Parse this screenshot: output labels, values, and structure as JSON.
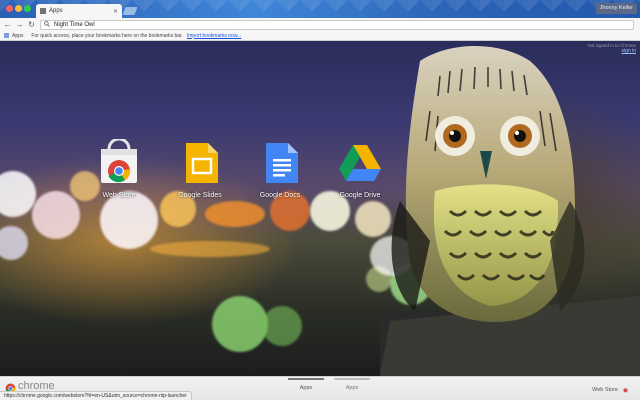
{
  "window": {
    "tab_title": "Night Time Owl",
    "tab_label": "Apps",
    "profile_name": "Jhonny Keller"
  },
  "toolbar": {
    "omnibox_text": "Night Time Owl"
  },
  "bookmarks": {
    "apps_label": "Apps",
    "hint_text": "For quick access, place your bookmarks here on the bookmarks bar.",
    "import_link": "Import bookmarks now..."
  },
  "account": {
    "signed_out_note": "Not signed in to Chrome",
    "signin_link": "sign in"
  },
  "apps": [
    {
      "label": "Web Store",
      "icon": "chrome-web-store-icon"
    },
    {
      "label": "Google Slides",
      "icon": "google-slides-icon"
    },
    {
      "label": "Google Docs",
      "icon": "google-docs-icon"
    },
    {
      "label": "Google Drive",
      "icon": "google-drive-icon"
    }
  ],
  "footer": {
    "brand": "chrome",
    "tabs": [
      "Apps",
      "Apps"
    ],
    "webstore_label": "Web Store"
  },
  "status": {
    "url": "https://chrome.google.com/webstore?hl=en-US&utm_source=chrome-ntp-launcher"
  },
  "colors": {
    "titlebar": "#3f86d8",
    "link": "#1a55d8"
  }
}
